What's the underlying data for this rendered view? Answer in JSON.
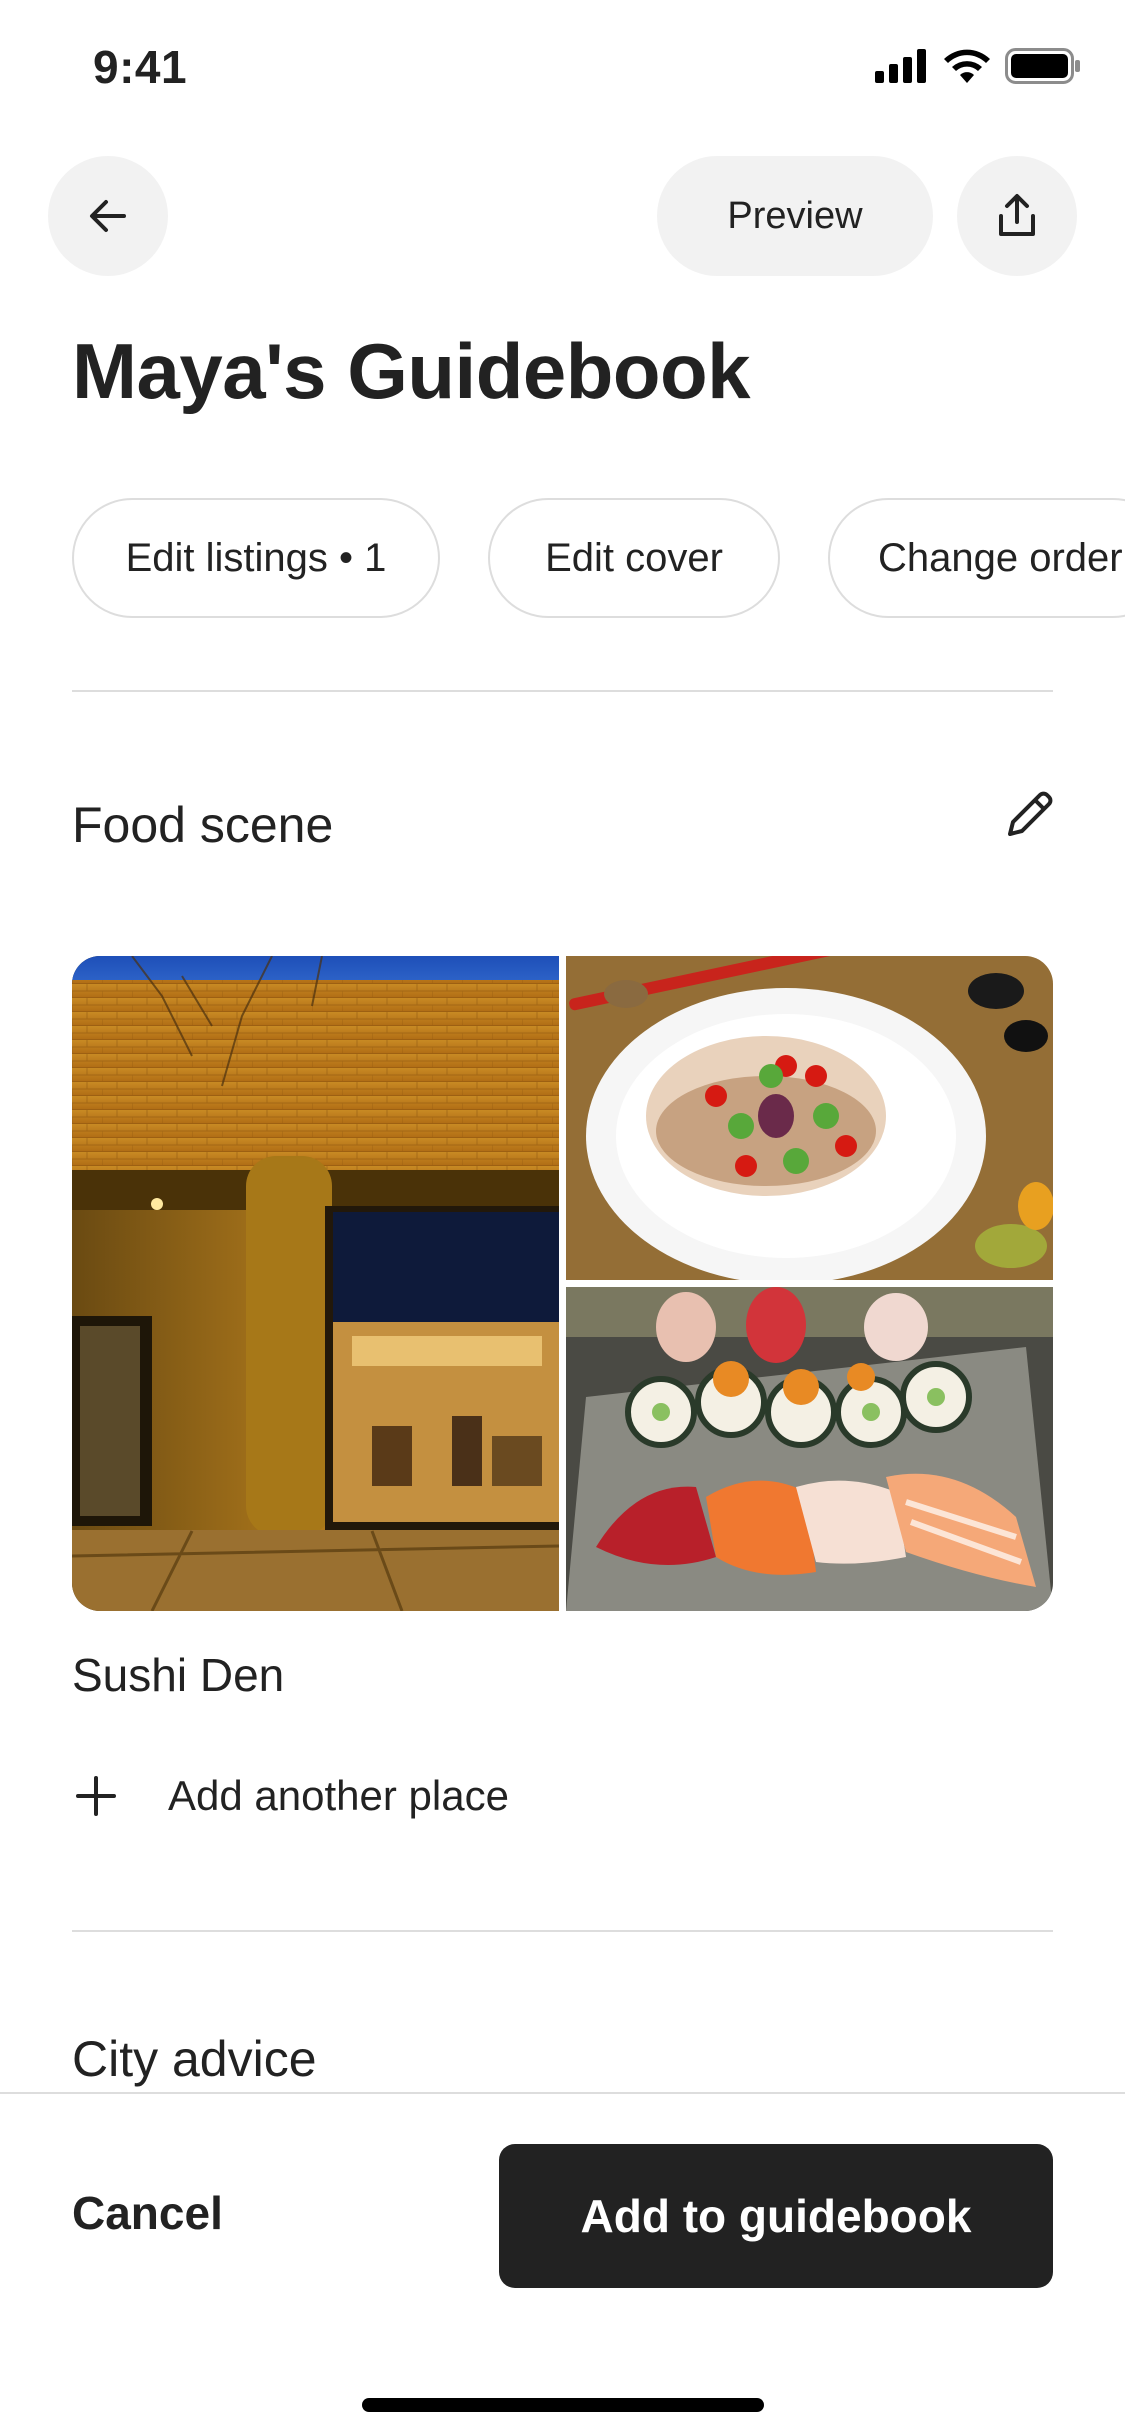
{
  "status_bar": {
    "time": "9:41"
  },
  "header": {
    "preview_label": "Preview",
    "title": "Maya's Guidebook"
  },
  "chips": [
    {
      "label": "Edit listings • 1"
    },
    {
      "label": "Edit cover"
    },
    {
      "label": "Change order"
    }
  ],
  "sections": [
    {
      "title": "Food scene",
      "place_name": "Sushi Den",
      "add_label": "Add another place"
    },
    {
      "title": "City advice"
    }
  ],
  "footer": {
    "cancel_label": "Cancel",
    "primary_label": "Add to guidebook"
  },
  "colors": {
    "text": "#222222",
    "button_bg": "#f2f2f2",
    "primary_bg": "#222222",
    "divider": "#dddddd"
  }
}
